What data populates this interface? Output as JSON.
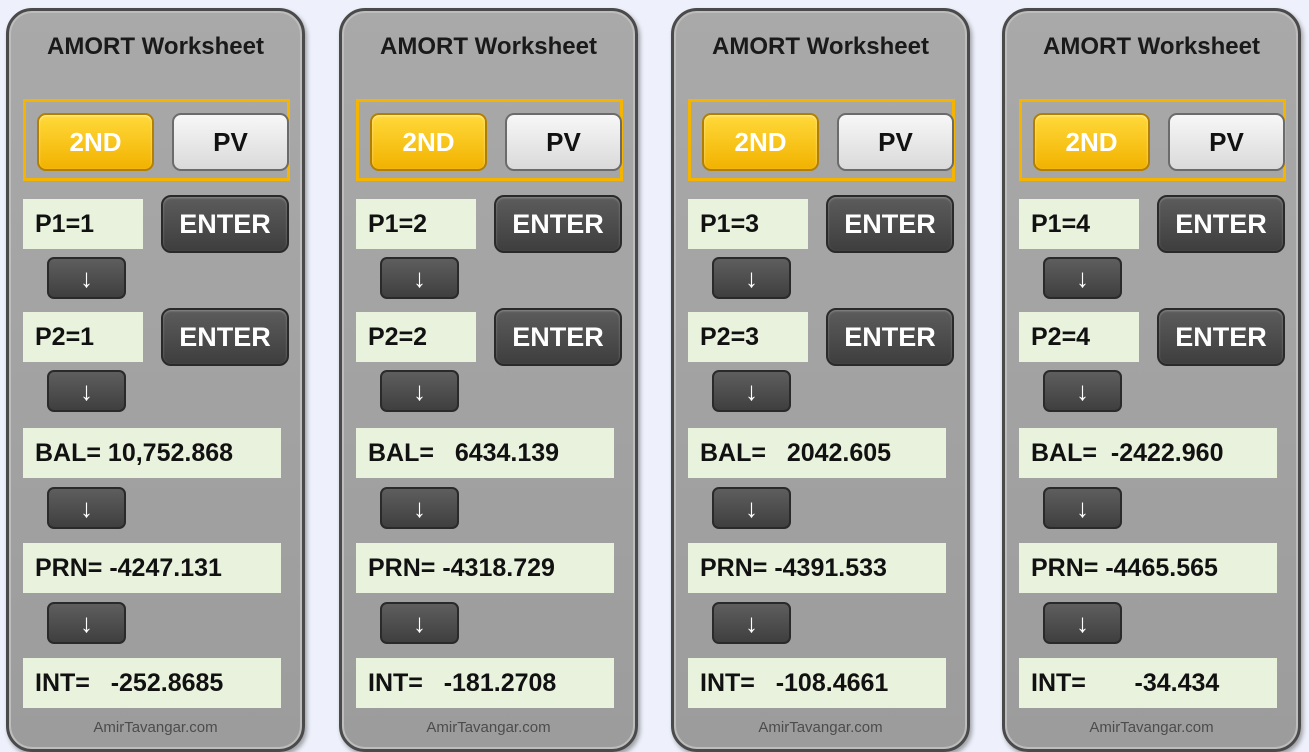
{
  "panels": [
    {
      "title": "AMORT Worksheet",
      "key_2nd": "2ND",
      "key_pv": "PV",
      "p1": "P1=1",
      "p2": "P2=1",
      "enter": "ENTER",
      "arrow": "↓",
      "bal": "BAL= 10,752.868",
      "prn": "PRN= -4247.131",
      "int": "INT=   -252.8685",
      "footer": "AmirTavangar.com"
    },
    {
      "title": "AMORT Worksheet",
      "key_2nd": "2ND",
      "key_pv": "PV",
      "p1": "P1=2",
      "p2": "P2=2",
      "enter": "ENTER",
      "arrow": "↓",
      "bal": "BAL=   6434.139",
      "prn": "PRN= -4318.729",
      "int": "INT=   -181.2708",
      "footer": "AmirTavangar.com"
    },
    {
      "title": "AMORT Worksheet",
      "key_2nd": "2ND",
      "key_pv": "PV",
      "p1": "P1=3",
      "p2": "P2=3",
      "enter": "ENTER",
      "arrow": "↓",
      "bal": "BAL=   2042.605",
      "prn": "PRN= -4391.533",
      "int": "INT=   -108.4661",
      "footer": "AmirTavangar.com"
    },
    {
      "title": "AMORT Worksheet",
      "key_2nd": "2ND",
      "key_pv": "PV",
      "p1": "P1=4",
      "p2": "P2=4",
      "enter": "ENTER",
      "arrow": "↓",
      "bal": "BAL=  -2422.960",
      "prn": "PRN= -4465.565",
      "int": "INT=       -34.434",
      "footer": "AmirTavangar.com"
    }
  ],
  "colors": {
    "accent_yellow": "#f5b400",
    "field_green": "#e9f2dd",
    "panel_gray": "#a5a5a5",
    "dark_key": "#4a4a4a"
  }
}
